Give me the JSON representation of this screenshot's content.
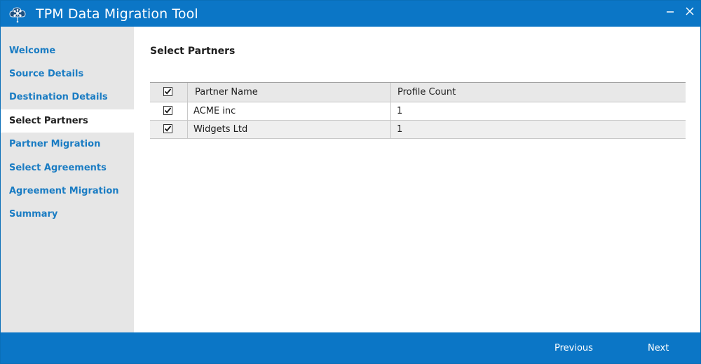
{
  "window": {
    "title": "TPM Data Migration Tool"
  },
  "sidebar": {
    "items": [
      {
        "label": "Welcome",
        "active": false
      },
      {
        "label": "Source Details",
        "active": false
      },
      {
        "label": "Destination Details",
        "active": false
      },
      {
        "label": "Select Partners",
        "active": true
      },
      {
        "label": "Partner Migration",
        "active": false
      },
      {
        "label": "Select Agreements",
        "active": false
      },
      {
        "label": "Agreement Migration",
        "active": false
      },
      {
        "label": "Summary",
        "active": false
      }
    ]
  },
  "main": {
    "title": "Select Partners",
    "grid": {
      "columns": [
        "Partner Name",
        "Profile Count"
      ],
      "select_all_checked": true,
      "rows": [
        {
          "checked": true,
          "partner_name": "ACME inc",
          "profile_count": "1"
        },
        {
          "checked": true,
          "partner_name": "Widgets Ltd",
          "profile_count": "1"
        }
      ]
    }
  },
  "footer": {
    "previous_label": "Previous",
    "next_label": "Next"
  },
  "colors": {
    "accent": "#0b76c6",
    "nav_link": "#1a7cc3",
    "sidebar_bg": "#e6e6e6"
  },
  "icons": {
    "app": "network-cube-icon",
    "minimize": "minimize-icon",
    "close": "close-icon",
    "check": "checkmark-icon"
  }
}
